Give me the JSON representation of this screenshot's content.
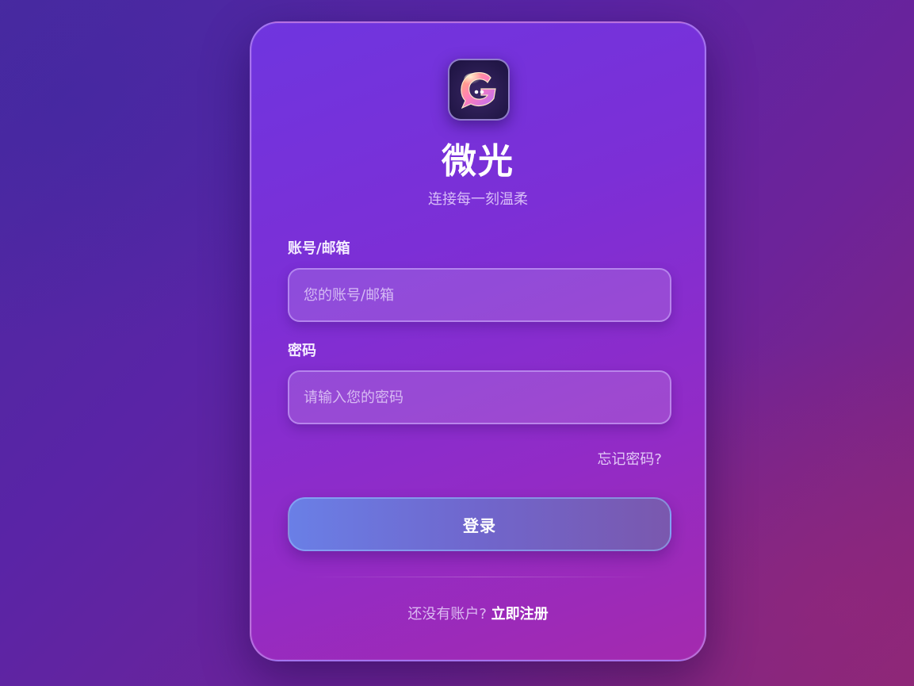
{
  "app": {
    "title": "微光",
    "tagline": "连接每一刻温柔",
    "logo_icon": "chat-bubble-g-logo-icon"
  },
  "form": {
    "account_label": "账号/邮箱",
    "account_placeholder": "您的账号/邮箱",
    "account_value": "",
    "password_label": "密码",
    "password_placeholder": "请输入您的密码",
    "password_value": "",
    "forgot_link": "忘记密码?",
    "login_button": "登录"
  },
  "footer": {
    "register_prompt": "还没有账户?",
    "register_link": "立即注册"
  },
  "colors": {
    "background_start": "#4a2aa0",
    "background_end": "#8a2677",
    "card_top": "#6f35df",
    "card_bottom": "#a42aae",
    "button_start": "#6a7fe6",
    "button_end": "#7a58ae"
  }
}
